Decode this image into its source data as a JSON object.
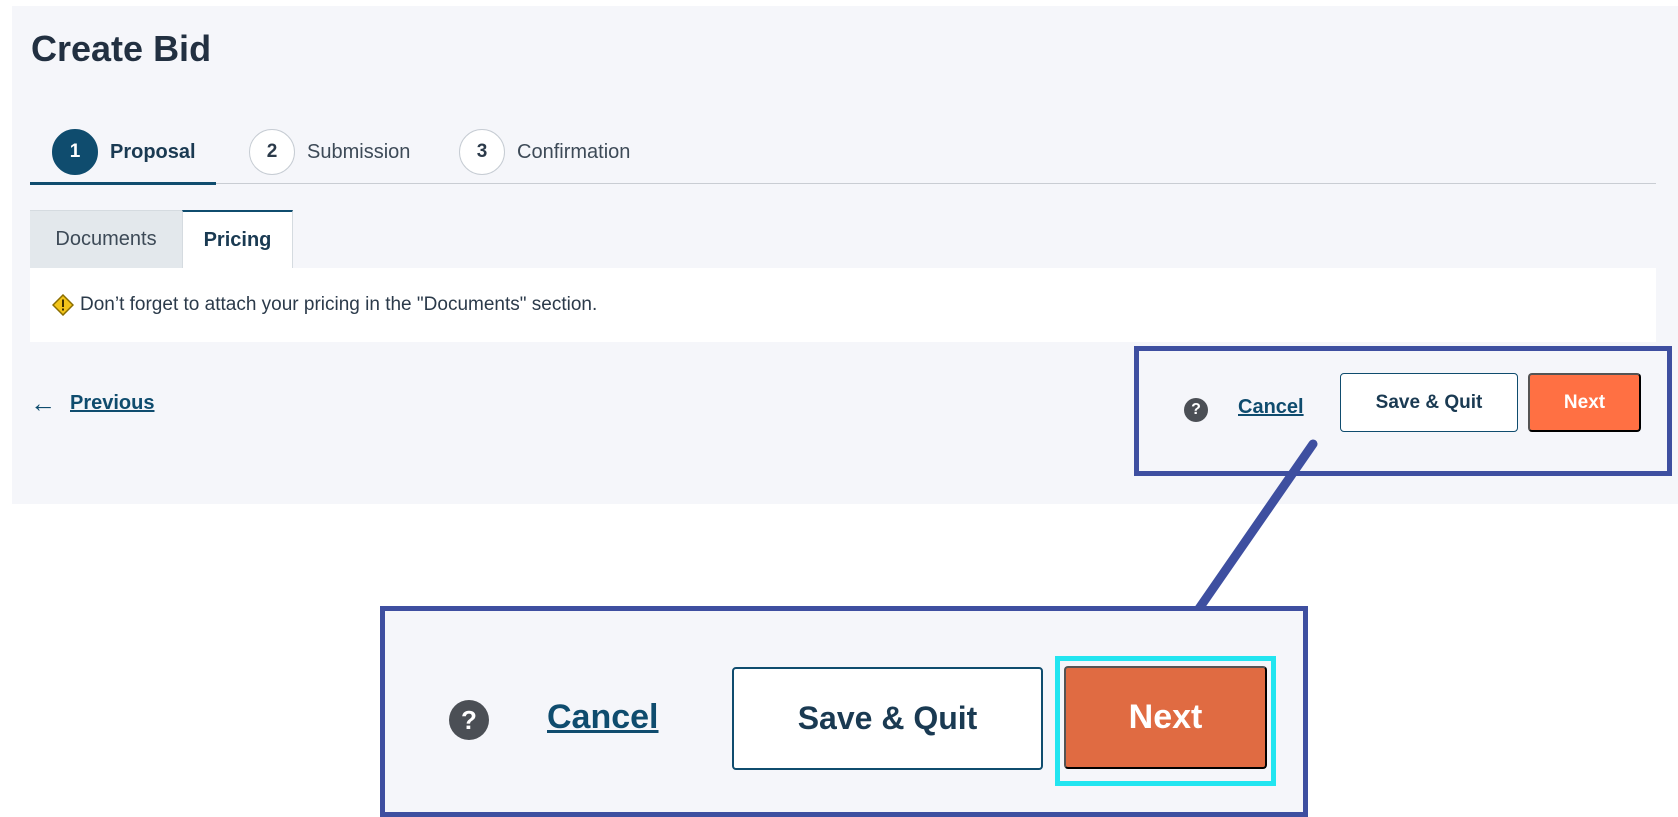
{
  "page": {
    "title": "Create Bid"
  },
  "stepper": {
    "steps": [
      {
        "number": "1",
        "label": "Proposal",
        "active": true
      },
      {
        "number": "2",
        "label": "Submission",
        "active": false
      },
      {
        "number": "3",
        "label": "Confirmation",
        "active": false
      }
    ]
  },
  "subtabs": {
    "documents": "Documents",
    "pricing": "Pricing"
  },
  "notice": {
    "text": "Don’t forget to attach your pricing in the \"Documents\" section.",
    "icon": "warning-diamond-icon"
  },
  "footer": {
    "previous_label": "Previous",
    "previous_icon": "arrow-left-icon",
    "help_icon": "question-circle-icon",
    "help_glyph": "?",
    "cancel_label": "Cancel",
    "save_quit_label": "Save & Quit",
    "next_label": "Next"
  },
  "zoom": {
    "help_glyph": "?",
    "cancel_label": "Cancel",
    "save_quit_label": "Save & Quit",
    "next_label": "Next"
  },
  "colors": {
    "brand": "#0f4c6e",
    "primary_button": "#ff7043",
    "zoom_primary_button": "#e06b42",
    "highlight_box": "#3e4fa0",
    "focus_highlight": "#22e5f0",
    "panel_bg": "#f5f6fa"
  }
}
